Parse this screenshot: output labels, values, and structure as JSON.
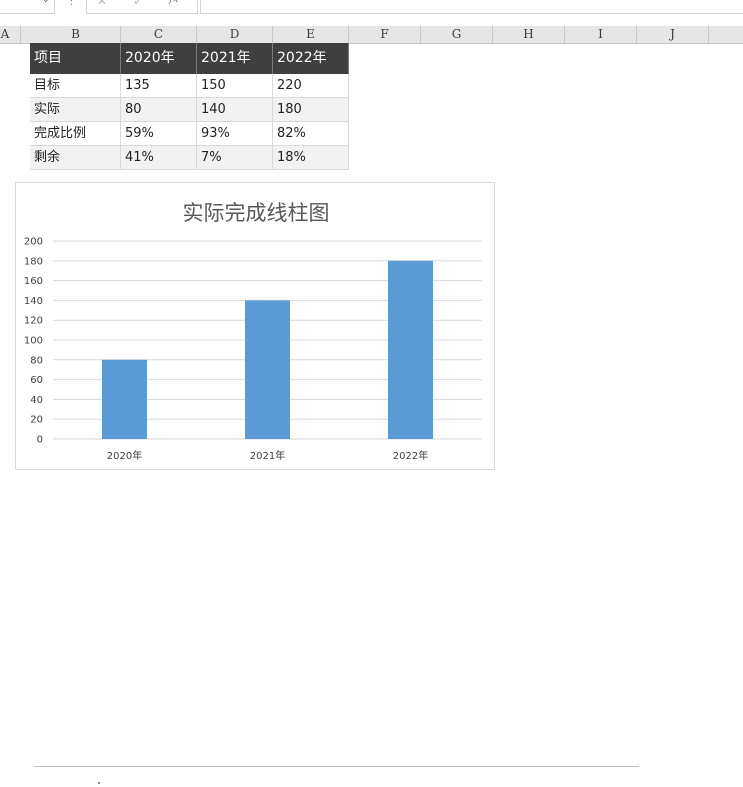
{
  "formula_bar": {
    "cancel_icon": "x-icon",
    "enter_icon": "check-icon",
    "fx_label": "fx",
    "value": ""
  },
  "columns": [
    "A",
    "B",
    "C",
    "D",
    "E",
    "F",
    "G",
    "H",
    "I",
    "J"
  ],
  "table": {
    "header": [
      "项目",
      "2020年",
      "2021年",
      "2022年"
    ],
    "rows": [
      [
        "目标",
        "135",
        "150",
        "220"
      ],
      [
        "实际",
        "80",
        "140",
        "180"
      ],
      [
        "完成比例",
        "59%",
        "93%",
        "82%"
      ],
      [
        "剩余",
        "41%",
        "7%",
        "18%"
      ]
    ],
    "header_bg": "#3f3f3f",
    "alt_row_bg": "#f2f2f2"
  },
  "chart_data": {
    "type": "bar",
    "title": "实际完成线柱图",
    "categories": [
      "2020年",
      "2021年",
      "2022年"
    ],
    "series": [
      {
        "values": [
          80,
          140,
          180
        ],
        "color": "#5b9bd5"
      }
    ],
    "ylim": [
      0,
      200
    ],
    "yticks": [
      0,
      20,
      40,
      60,
      80,
      100,
      120,
      140,
      160,
      180,
      200
    ],
    "xlabel": "",
    "ylabel": "",
    "grid": true,
    "legend": "none"
  }
}
